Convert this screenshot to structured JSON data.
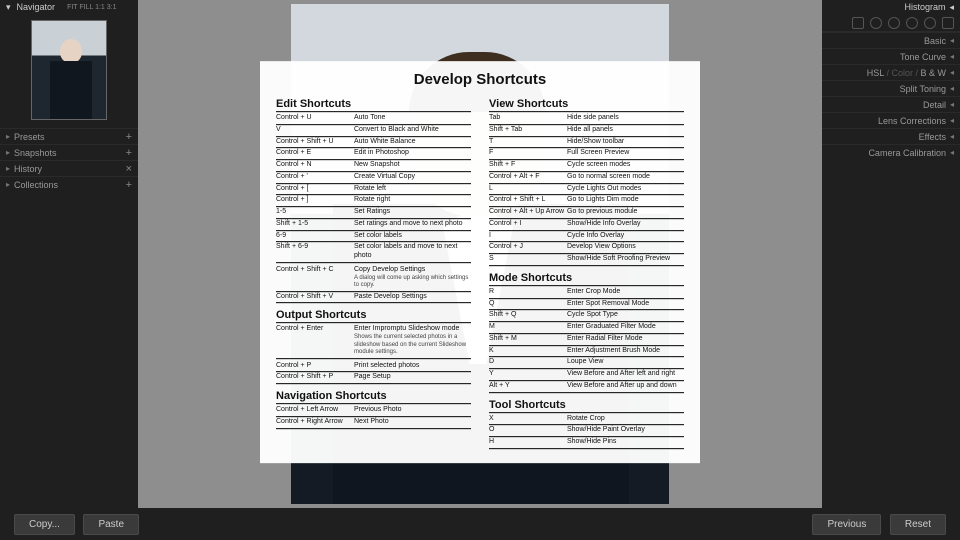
{
  "left_panel": {
    "navigator_label": "Navigator",
    "zoom_labels": "FIT  FILL  1:1  3:1",
    "rows": [
      {
        "label": "Presets",
        "action": "+"
      },
      {
        "label": "Snapshots",
        "action": "+"
      },
      {
        "label": "History",
        "action": "×"
      },
      {
        "label": "Collections",
        "action": "+"
      }
    ]
  },
  "right_panel": {
    "histogram_label": "Histogram",
    "rows": [
      {
        "label": "Basic"
      },
      {
        "label": "Tone Curve"
      },
      {
        "prefix": "HSL",
        "mid": " / Color / ",
        "suffix": "B & W"
      },
      {
        "label": "Split Toning"
      },
      {
        "label": "Detail"
      },
      {
        "label": "Lens Corrections"
      },
      {
        "label": "Effects"
      },
      {
        "label": "Camera Calibration"
      }
    ]
  },
  "bottom": {
    "copy": "Copy...",
    "paste": "Paste",
    "previous": "Previous",
    "reset": "Reset"
  },
  "overlay": {
    "title": "Develop Shortcuts",
    "left_sections": [
      {
        "title": "Edit Shortcuts",
        "rows": [
          {
            "k": "Control + U",
            "a": "Auto Tone"
          },
          {
            "k": "V",
            "a": "Convert to Black and White"
          },
          {
            "k": "Control + Shift + U",
            "a": "Auto White Balance"
          },
          {
            "k": "Control + E",
            "a": "Edit in Photoshop"
          },
          {
            "k": "Control + N",
            "a": "New Snapshot"
          },
          {
            "k": "Control + '",
            "a": "Create Virtual Copy"
          },
          {
            "k": "Control + [",
            "a": "Rotate left"
          },
          {
            "k": "Control + ]",
            "a": "Rotate right"
          },
          {
            "k": "1-5",
            "a": "Set Ratings"
          },
          {
            "k": "Shift + 1-5",
            "a": "Set ratings and move to next photo"
          },
          {
            "k": "6-9",
            "a": "Set color labels"
          },
          {
            "k": "Shift + 6-9",
            "a": "Set color labels and move to next photo"
          },
          {
            "k": "",
            "a": ""
          },
          {
            "k": "Control + Shift + C",
            "a": "Copy Develop Settings",
            "note": "A dialog will come up asking which settings to copy."
          },
          {
            "k": "Control + Shift + V",
            "a": "Paste Develop Settings"
          }
        ]
      },
      {
        "title": "Output Shortcuts",
        "rows": [
          {
            "k": "Control + Enter",
            "a": "Enter Impromptu Slideshow mode",
            "note": "Shows the current selected photos in a slideshow based on the current Slideshow module settings."
          },
          {
            "k": "",
            "a": ""
          },
          {
            "k": "Control + P",
            "a": "Print selected photos"
          },
          {
            "k": "Control + Shift + P",
            "a": "Page Setup"
          }
        ]
      },
      {
        "title": "Navigation Shortcuts",
        "rows": [
          {
            "k": "Control + Left Arrow",
            "a": "Previous Photo"
          },
          {
            "k": "Control + Right Arrow",
            "a": "Next Photo"
          }
        ]
      }
    ],
    "right_sections": [
      {
        "title": "View Shortcuts",
        "rows": [
          {
            "k": "Tab",
            "a": "Hide side panels"
          },
          {
            "k": "Shift + Tab",
            "a": "Hide all panels"
          },
          {
            "k": "T",
            "a": "Hide/Show toolbar"
          },
          {
            "k": "F",
            "a": "Full Screen Preview"
          },
          {
            "k": "Shift + F",
            "a": "Cycle screen modes"
          },
          {
            "k": "Control + Alt + F",
            "a": "Go to normal screen mode"
          },
          {
            "k": "L",
            "a": "Cycle Lights Out modes"
          },
          {
            "k": "Control + Shift + L",
            "a": "Go to Lights Dim mode"
          },
          {
            "k": "Control + Alt + Up Arrow",
            "a": "Go to previous module"
          },
          {
            "k": "Control + I",
            "a": "Show/Hide Info Overlay"
          },
          {
            "k": "I",
            "a": "Cycle Info Overlay"
          },
          {
            "k": "Control + J",
            "a": "Develop View Options"
          },
          {
            "k": "S",
            "a": "Show/Hide Soft Proofing Preview"
          }
        ]
      },
      {
        "title": "Mode Shortcuts",
        "rows": [
          {
            "k": "R",
            "a": "Enter Crop Mode"
          },
          {
            "k": "Q",
            "a": "Enter Spot Removal Mode"
          },
          {
            "k": "Shift + Q",
            "a": "Cycle Spot Type"
          },
          {
            "k": "M",
            "a": "Enter Graduated Filter Mode"
          },
          {
            "k": "Shift + M",
            "a": "Enter Radial Filter Mode"
          },
          {
            "k": "K",
            "a": "Enter Adjustment Brush Mode"
          },
          {
            "k": "D",
            "a": "Loupe View"
          },
          {
            "k": "Y",
            "a": "View Before and After left and right"
          },
          {
            "k": "Alt + Y",
            "a": "View Before and After up and down"
          }
        ]
      },
      {
        "title": "Tool Shortcuts",
        "rows": [
          {
            "k": "X",
            "a": "Rotate Crop"
          },
          {
            "k": "O",
            "a": "Show/Hide Paint Overlay"
          },
          {
            "k": "H",
            "a": "Show/Hide Pins"
          }
        ]
      }
    ]
  }
}
